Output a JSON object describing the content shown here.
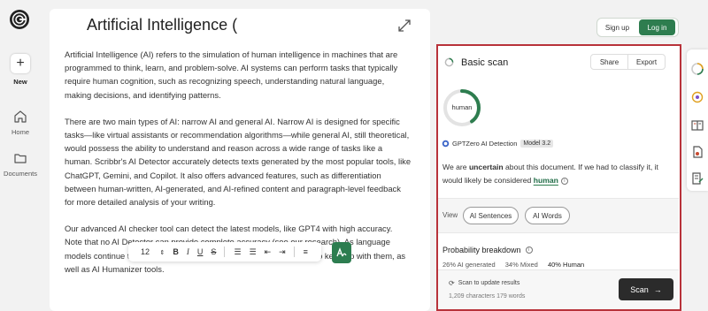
{
  "app": {
    "name": "GPTZero"
  },
  "rail": {
    "new_label": "New",
    "home_label": "Home",
    "documents_label": "Documents"
  },
  "editor": {
    "title": "Artificial Intelligence (",
    "paragraphs": [
      "Artificial Intelligence (AI) refers to the simulation of human intelligence in machines that are programmed to think, learn, and problem-solve. AI systems can perform tasks that typically require human cognition, such as recognizing speech, understanding natural language, making decisions, and identifying patterns.",
      "There are two main types of AI: narrow AI and general AI. Narrow AI is designed for specific tasks—like virtual assistants or recommendation algorithms—while general AI, still theoretical, would possess the ability to understand and reason across a wide range of tasks like a human. Scribbr's AI Detector accurately detects texts generated by the most popular tools, like ChatGPT, Gemini, and Copilot. It also offers advanced features, such as differentiation between human-written, AI-generated, and AI-refined content and paragraph-level feedback for more detailed analysis of your writing.",
      "Our advanced AI checker tool can detect the latest models, like GPT4 with high accuracy. Note that no AI Detector can provide complete accuracy (see our research). As language models continue to develop, detection tools will always have to race to keep up with them, as well as AI Humanizer tools."
    ],
    "font_size": "12"
  },
  "auth": {
    "signup": "Sign up",
    "login": "Log in"
  },
  "scan": {
    "title": "Basic scan",
    "share": "Share",
    "export": "Export",
    "result_label": "human",
    "human_fraction": 0.4,
    "detector_name": "GPTZero AI Detection",
    "model_badge": "Model 3.2",
    "verdict_pre": "We are ",
    "verdict_bold": "uncertain",
    "verdict_mid": " about this document. If we had to classify it, it would likely be considered ",
    "verdict_class": "human",
    "view_label": "View",
    "btn_sentences": "AI Sentences",
    "btn_words": "AI Words",
    "prob_title": "Probability breakdown",
    "prob_ai": "26% AI generated",
    "prob_mixed": "34% Mixed",
    "prob_human": "40% Human",
    "update_text": "Scan to update results",
    "char_count": "1,209 characters 179 words",
    "scan_button": "Scan"
  },
  "colors": {
    "accent": "#2e7d4f",
    "frame": "#b8323a",
    "dark_button": "#2b2b2b"
  }
}
